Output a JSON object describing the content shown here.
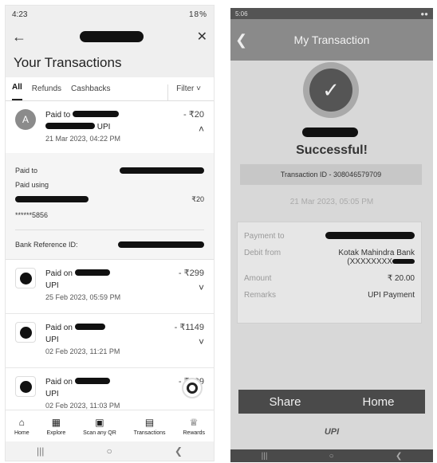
{
  "left": {
    "status": {
      "time": "4:23",
      "battery": "18%"
    },
    "title": "Your Transactions",
    "tabs": [
      "All",
      "Refunds",
      "Cashbacks"
    ],
    "filter_label": "Filter",
    "expanded": {
      "avatar_letter": "A",
      "paid_prefix": "Paid to",
      "method": "UPI",
      "amount": "- ₹20",
      "datetime": "21 Mar 2023, 04:22 PM",
      "detail_paid_to": "Paid to",
      "detail_paid_using": "Paid using",
      "detail_amount": "₹20",
      "card_mask": "******5856",
      "bank_ref_label": "Bank Reference ID:"
    },
    "items": [
      {
        "paid_prefix": "Paid on",
        "method": "UPI",
        "amount": "- ₹299",
        "datetime": "25 Feb 2023, 05:59 PM"
      },
      {
        "paid_prefix": "Paid on",
        "method": "UPI",
        "amount": "- ₹1149",
        "datetime": "02 Feb 2023, 11:21 PM"
      },
      {
        "paid_prefix": "Paid on",
        "method": "UPI",
        "amount": "- ₹599",
        "datetime": "02 Feb 2023, 11:03 PM"
      }
    ],
    "bottom_nav": [
      "Home",
      "Explore",
      "Scan any QR",
      "Transactions",
      "Rewards"
    ]
  },
  "right": {
    "status": {
      "time": "5:06"
    },
    "title": "My Transaction",
    "success_text": "Successful!",
    "transaction_id": "Transaction ID - 308046579709",
    "datetime": "21 Mar 2023, 05:05 PM",
    "rows": {
      "payment_to_label": "Payment to",
      "debit_from_label": "Debit from",
      "debit_from_bank": "Kotak Mahindra Bank",
      "debit_from_acct": "(XXXXXXXX",
      "amount_label": "Amount",
      "amount_value": "₹ 20.00",
      "remarks_label": "Remarks",
      "remarks_value": "UPI Payment"
    },
    "buttons": {
      "share": "Share",
      "home": "Home"
    },
    "footer_logo": "UPI"
  }
}
